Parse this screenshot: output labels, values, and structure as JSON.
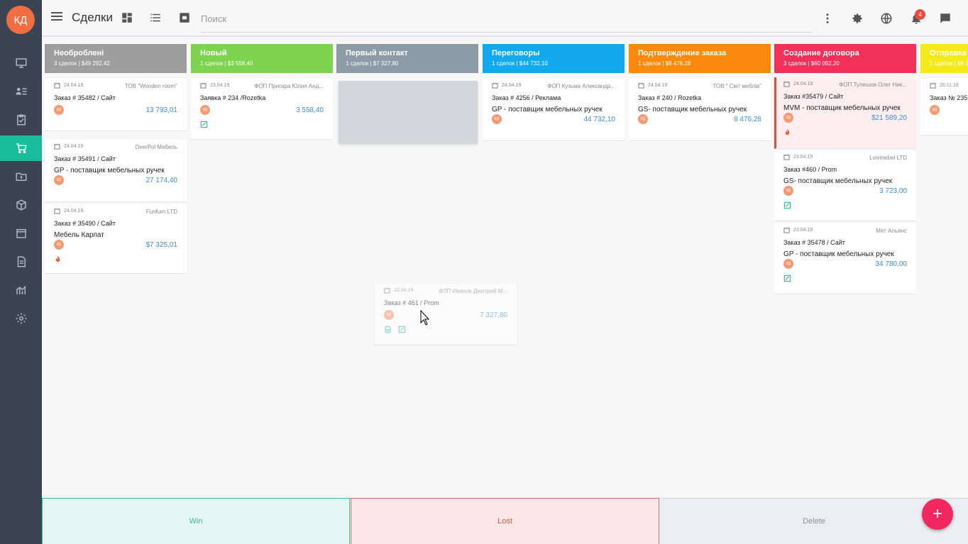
{
  "app": {
    "avatar_initials": "КД",
    "title": "Сделки"
  },
  "search": {
    "placeholder": "Поиск",
    "value": ""
  },
  "notifications": {
    "count": "4"
  },
  "sidebar": {
    "items": [
      {
        "icon": "monitor-icon"
      },
      {
        "icon": "contacts-icon"
      },
      {
        "icon": "clipboard-icon"
      },
      {
        "icon": "cart-icon",
        "active": true
      },
      {
        "icon": "folder-money-icon"
      },
      {
        "icon": "box-icon"
      },
      {
        "icon": "window-icon"
      },
      {
        "icon": "document-icon"
      },
      {
        "icon": "chart-icon"
      },
      {
        "icon": "settings-icon"
      }
    ]
  },
  "columns": [
    {
      "title": "Необроблені",
      "summary": "3 сделок | $49 292,42",
      "color": "#9e9e9e"
    },
    {
      "title": "Новый",
      "summary": "1 сделок | $3 558,40",
      "color": "#7ed34f"
    },
    {
      "title": "Первый контакт",
      "summary": "1 сделок | $7 327,80",
      "color": "#8c9ba5"
    },
    {
      "title": "Переговоры",
      "summary": "1 сделок | $44 732,10",
      "color": "#12a9ef"
    },
    {
      "title": "Подтверждение заказа",
      "summary": "1 сделок | $8 476,28",
      "color": "#f98a0e"
    },
    {
      "title": "Создание договора",
      "summary": "3 сделок | $60 092,20",
      "color": "#f2315a"
    },
    {
      "title": "Отправка",
      "summary": "1 сделок | $6 1",
      "color": "#f4e91a"
    }
  ],
  "cards": {
    "c1": {
      "date": "24.04.19",
      "company": "ТОВ \"Wooden room\"",
      "name": "Заказ # 35482 / Сайт",
      "avatar": "КД",
      "amount": "13 793,01"
    },
    "c2": {
      "date": "24.04.19",
      "company": "DverPol Мебель",
      "name": "Заказ # 35491 / Сайт",
      "desc": "GP - поставщик мебельных ручек",
      "avatar": "КД",
      "amount": "27 174,40"
    },
    "c3": {
      "date": "24.04.19",
      "company": "Funfurn LTD",
      "name": "Заказ # 35490 / Сайт",
      "desc": "Мебель Карпат",
      "avatar": "КД",
      "amount": "$7 325,01"
    },
    "c4": {
      "date": "23.04.19",
      "company": "ФОП Пригара Юлия Анд...",
      "name": "Заявка # 234 /Rozetka",
      "avatar": "КД",
      "amount": "3 558,40"
    },
    "c5": {
      "date": "24.04.19",
      "company": "ФОП Кузьма Александр...",
      "name": "Заказ # 4256 / Реклама",
      "desc": "GP - поставщик мебельных ручек",
      "avatar": "КД",
      "amount": "44 732,10"
    },
    "c6": {
      "date": "24.04.19",
      "company": "ТОВ \" Світ меблів\"",
      "name": "Заказ # 240 / Rozetka",
      "desc": "GS- поставщик мебельных ручек",
      "avatar": "КД",
      "amount": "8 476,28"
    },
    "c7": {
      "date": "24.04.19",
      "company": "ФОП Тулешов Олег Ник...",
      "name": "Заказ #35479 / Сайт",
      "desc": "MVM - поставщик мебельных ручек",
      "avatar": "КД",
      "amount": "$21 589,20"
    },
    "c8": {
      "date": "23.04.19",
      "company": "Lvivmebel LTD",
      "name": "Заказ #460 / Prom",
      "desc": "GS- поставщик мебельных ручек",
      "avatar": "КД",
      "amount": "3 723,00"
    },
    "c9": {
      "date": "23.04.19",
      "company": "Мет Альянс",
      "name": "Заказ # 35478 / Сайт",
      "desc": "GP - поставщик мебельных ручек",
      "avatar": "КД",
      "amount": "34 780,00"
    },
    "c10": {
      "date": "20.11.18",
      "name": "Заказ № 235",
      "avatar": "КД"
    },
    "drag": {
      "date": "23.04.19",
      "company": "ФЛП Иванов Дмитрий М...",
      "name": "Заказ # 461 / Prom",
      "avatar": "КД",
      "amount": "7 327,80"
    }
  },
  "drop_zones": {
    "win": "Win",
    "lost": "Lost",
    "delete": "Delete"
  },
  "fab": {
    "label": "+"
  }
}
